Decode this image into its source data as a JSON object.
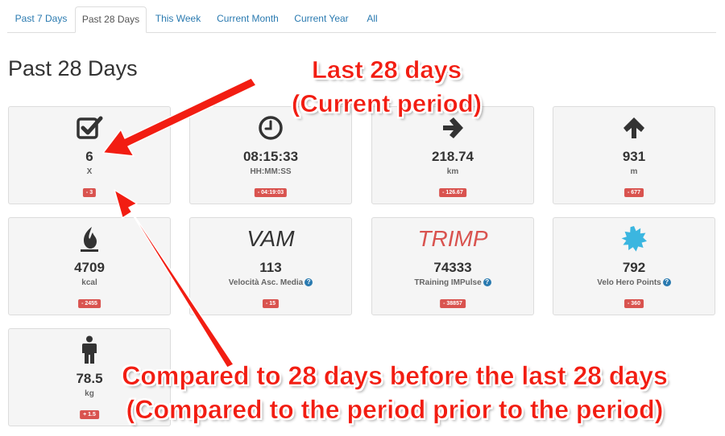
{
  "tabs": [
    {
      "label": "Past 7 Days",
      "active": false
    },
    {
      "label": "Past 28 Days",
      "active": true
    },
    {
      "label": "This Week",
      "active": false
    },
    {
      "label": "Current Month",
      "active": false
    },
    {
      "label": "Current Year",
      "active": false
    },
    {
      "label": "All",
      "active": false
    }
  ],
  "page_title": "Past 28 Days",
  "cards": [
    {
      "icon": "checkbox-icon",
      "value": "6",
      "unit": "X",
      "delta": "- 3"
    },
    {
      "icon": "clock-icon",
      "value": "08:15:33",
      "unit": "HH:MM:SS",
      "delta": "- 04:19:03"
    },
    {
      "icon": "arrow-right-icon",
      "value": "218.74",
      "unit": "km",
      "delta": "- 126.67"
    },
    {
      "icon": "arrow-up-icon",
      "value": "931",
      "unit": "m",
      "delta": "- 677"
    },
    {
      "icon": "fire-icon",
      "value": "4709",
      "unit": "kcal",
      "delta": "- 2455"
    },
    {
      "icon_text": "VAM",
      "value": "113",
      "unit": "Velocità Asc. Media",
      "delta": "- 15"
    },
    {
      "icon_text": "TRIMP",
      "value": "74333",
      "unit": "TRaining IMPulse",
      "delta": "- 38857"
    },
    {
      "icon": "badge-star-icon",
      "value": "792",
      "unit": "Velo Hero Points",
      "delta": "- 360"
    },
    {
      "icon": "person-icon",
      "value": "78.5",
      "unit": "kg",
      "delta": "+ 1.5"
    }
  ],
  "help_glyph": "?",
  "annotations": {
    "top_line1": "Last 28 days",
    "top_line2": "(Current period)",
    "bottom_line1": "Compared to 28 days before the last 28 days",
    "bottom_line2": "(Compared to the period prior to the period)"
  },
  "colors": {
    "link": "#2a7ab0",
    "badge": "#d9534f",
    "annotation": "#f21d12",
    "card_bg": "#f5f5f5"
  }
}
